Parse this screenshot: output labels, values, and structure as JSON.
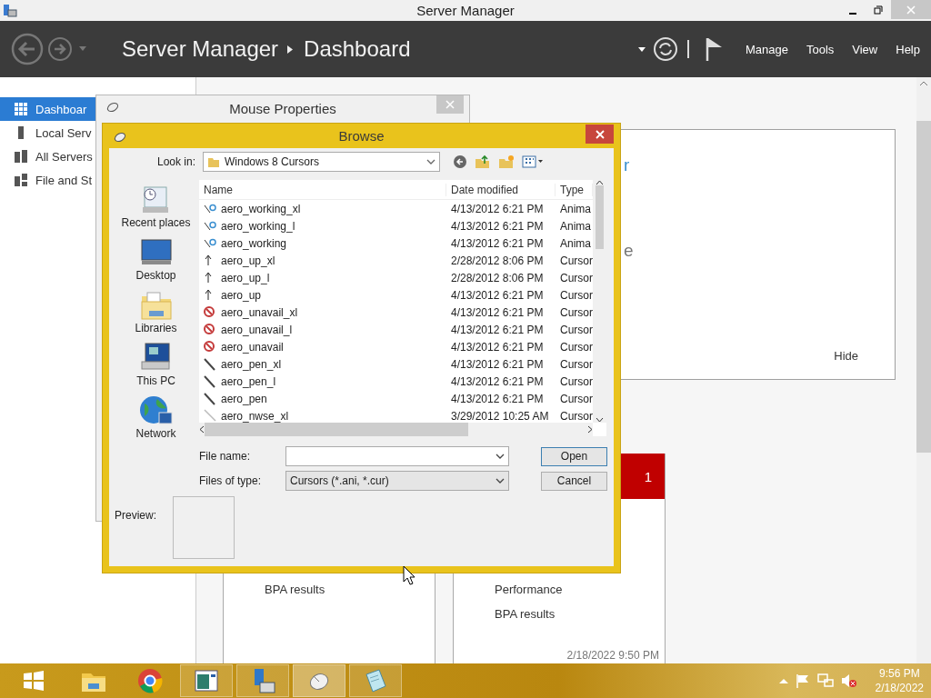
{
  "window": {
    "title": "Server Manager"
  },
  "header": {
    "breadcrumb": [
      "Server Manager",
      "Dashboard"
    ],
    "menu": [
      "Manage",
      "Tools",
      "View",
      "Help"
    ]
  },
  "sidebar": {
    "items": [
      {
        "label": "Dashboar",
        "kind": "dashboard",
        "selected": true
      },
      {
        "label": "Local Serv",
        "kind": "server",
        "selected": false
      },
      {
        "label": "All Servers",
        "kind": "servers",
        "selected": false
      },
      {
        "label": "File and St",
        "kind": "files",
        "selected": false
      }
    ]
  },
  "welcome_panel": {
    "fragments": [
      "r",
      "e"
    ],
    "hide": "Hide"
  },
  "tiles": [
    {
      "links": [
        "BPA results"
      ]
    },
    {
      "badge": "1",
      "links": [
        "Performance",
        "BPA results"
      ],
      "timestamp": "2/18/2022 9:50 PM"
    }
  ],
  "mouse_properties": {
    "title": "Mouse Properties"
  },
  "browse": {
    "title": "Browse",
    "look_in_label": "Look in:",
    "look_in": "Windows 8 Cursors",
    "places": [
      {
        "label": "Recent places",
        "kind": "recent"
      },
      {
        "label": "Desktop",
        "kind": "desktop"
      },
      {
        "label": "Libraries",
        "kind": "libraries"
      },
      {
        "label": "This PC",
        "kind": "pc"
      },
      {
        "label": "Network",
        "kind": "network"
      }
    ],
    "columns": [
      "Name",
      "Date modified",
      "Type"
    ],
    "files": [
      {
        "name": "aero_working_xl",
        "date": "4/13/2012 6:21 PM",
        "type": "Anima",
        "kind": "working"
      },
      {
        "name": "aero_working_l",
        "date": "4/13/2012 6:21 PM",
        "type": "Anima",
        "kind": "working"
      },
      {
        "name": "aero_working",
        "date": "4/13/2012 6:21 PM",
        "type": "Anima",
        "kind": "working"
      },
      {
        "name": "aero_up_xl",
        "date": "2/28/2012 8:06 PM",
        "type": "Cursor",
        "kind": "up"
      },
      {
        "name": "aero_up_l",
        "date": "2/28/2012 8:06 PM",
        "type": "Cursor",
        "kind": "up"
      },
      {
        "name": "aero_up",
        "date": "4/13/2012 6:21 PM",
        "type": "Cursor",
        "kind": "up"
      },
      {
        "name": "aero_unavail_xl",
        "date": "4/13/2012 6:21 PM",
        "type": "Cursor",
        "kind": "unavail"
      },
      {
        "name": "aero_unavail_l",
        "date": "4/13/2012 6:21 PM",
        "type": "Cursor",
        "kind": "unavail"
      },
      {
        "name": "aero_unavail",
        "date": "4/13/2012 6:21 PM",
        "type": "Cursor",
        "kind": "unavail"
      },
      {
        "name": "aero_pen_xl",
        "date": "4/13/2012 6:21 PM",
        "type": "Cursor",
        "kind": "pen"
      },
      {
        "name": "aero_pen_l",
        "date": "4/13/2012 6:21 PM",
        "type": "Cursor",
        "kind": "pen"
      },
      {
        "name": "aero_pen",
        "date": "4/13/2012 6:21 PM",
        "type": "Cursor",
        "kind": "pen"
      },
      {
        "name": "aero_nwse_xl",
        "date": "3/29/2012 10:25 AM",
        "type": "Cursor",
        "kind": "nwse"
      }
    ],
    "file_name_label": "File name:",
    "type_label": "Files of type:",
    "file_type": "Cursors (*.ani, *.cur)",
    "buttons": [
      {
        "label": "Open",
        "kind": "default"
      },
      {
        "label": "Cancel",
        "kind": "normal"
      }
    ],
    "preview_label": "Preview:"
  },
  "taskbar": {
    "apps": [
      {
        "kind": "explorer",
        "running": false,
        "selected": false
      },
      {
        "kind": "chrome",
        "running": false,
        "selected": false
      },
      {
        "kind": "window",
        "running": true,
        "selected": false
      },
      {
        "kind": "network",
        "running": true,
        "selected": false
      },
      {
        "kind": "mouse",
        "running": true,
        "selected": true
      },
      {
        "kind": "notepad",
        "running": true,
        "selected": false
      }
    ],
    "clock": {
      "time": "9:56 PM",
      "date": "2/18/2022"
    }
  }
}
